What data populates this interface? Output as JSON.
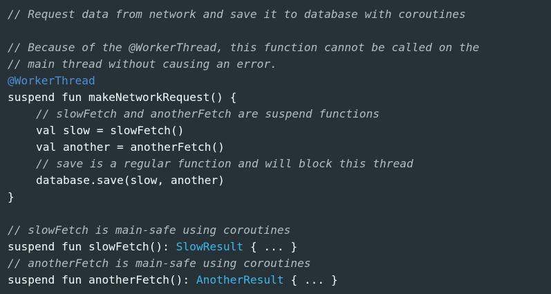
{
  "code_panel": {
    "line1": {
      "comment": "// Request data from network and save it to database with coroutines"
    },
    "line2": {},
    "line3": {
      "comment": "// Because of the @WorkerThread, this function cannot be called on the"
    },
    "line4": {
      "comment": "// main thread without causing an error."
    },
    "line5": {
      "annotation": "@WorkerThread"
    },
    "line6": {
      "code": "suspend fun makeNetworkRequest() {"
    },
    "line7": {
      "comment": "// slowFetch and anotherFetch are suspend functions"
    },
    "line8": {
      "code": "val slow = slowFetch()"
    },
    "line9": {
      "code": "val another = anotherFetch()"
    },
    "line10": {
      "comment": "// save is a regular function and will block this thread"
    },
    "line11": {
      "code": "database.save(slow, another)"
    },
    "line12": {
      "code": "}"
    },
    "line13": {},
    "line14": {
      "comment": "// slowFetch is main-safe using coroutines"
    },
    "line15": {
      "code_before": "suspend fun slowFetch(): ",
      "type": "SlowResult",
      "code_after": " { ... }"
    },
    "line16": {
      "comment": "// anotherFetch is main-safe using coroutines"
    },
    "line17": {
      "code_before": "suspend fun anotherFetch(): ",
      "type": "AnotherResult",
      "code_after": " { ... }"
    }
  },
  "colors": {
    "background": "#263238",
    "plain": "#eeffff",
    "comment": "#b0bec5",
    "annotation": "#4f8fd6",
    "type": "#3fb6e8"
  }
}
